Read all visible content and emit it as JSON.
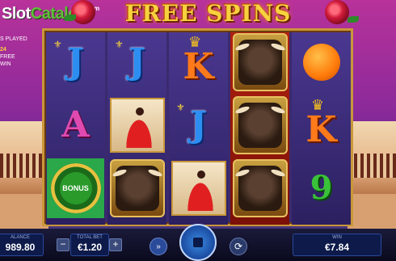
{
  "watermark": {
    "slot": "Slot",
    "catalog": "Catalog",
    "com": "com"
  },
  "title": "FREE SPINS",
  "side_info": {
    "played_label": "S PLAYED",
    "free_count": "24",
    "free_label": "FREE",
    "win_label": "WIN"
  },
  "reels": [
    [
      "J",
      "A",
      "emblem"
    ],
    [
      "J",
      "dancer",
      "bull"
    ],
    [
      "K",
      "J",
      "dancer"
    ],
    [
      "bull",
      "bull",
      "bull"
    ],
    [
      "orange",
      "K",
      "9"
    ]
  ],
  "emblem_text": "BONUS",
  "footer": {
    "balance_label": "ALANCE",
    "balance_value": "989.80",
    "total_bet_label": "TOTAL BET",
    "total_bet_value": "€1.20",
    "minus": "−",
    "plus": "+",
    "win_label": "WIN",
    "win_value": "€7.84",
    "turbo_icon": "»",
    "autoplay_icon": "⟳"
  },
  "colors": {
    "accent_gold": "#f7d23e",
    "panel_bg": "#0d1a4a",
    "spin_blue": "#3a8ae0"
  }
}
